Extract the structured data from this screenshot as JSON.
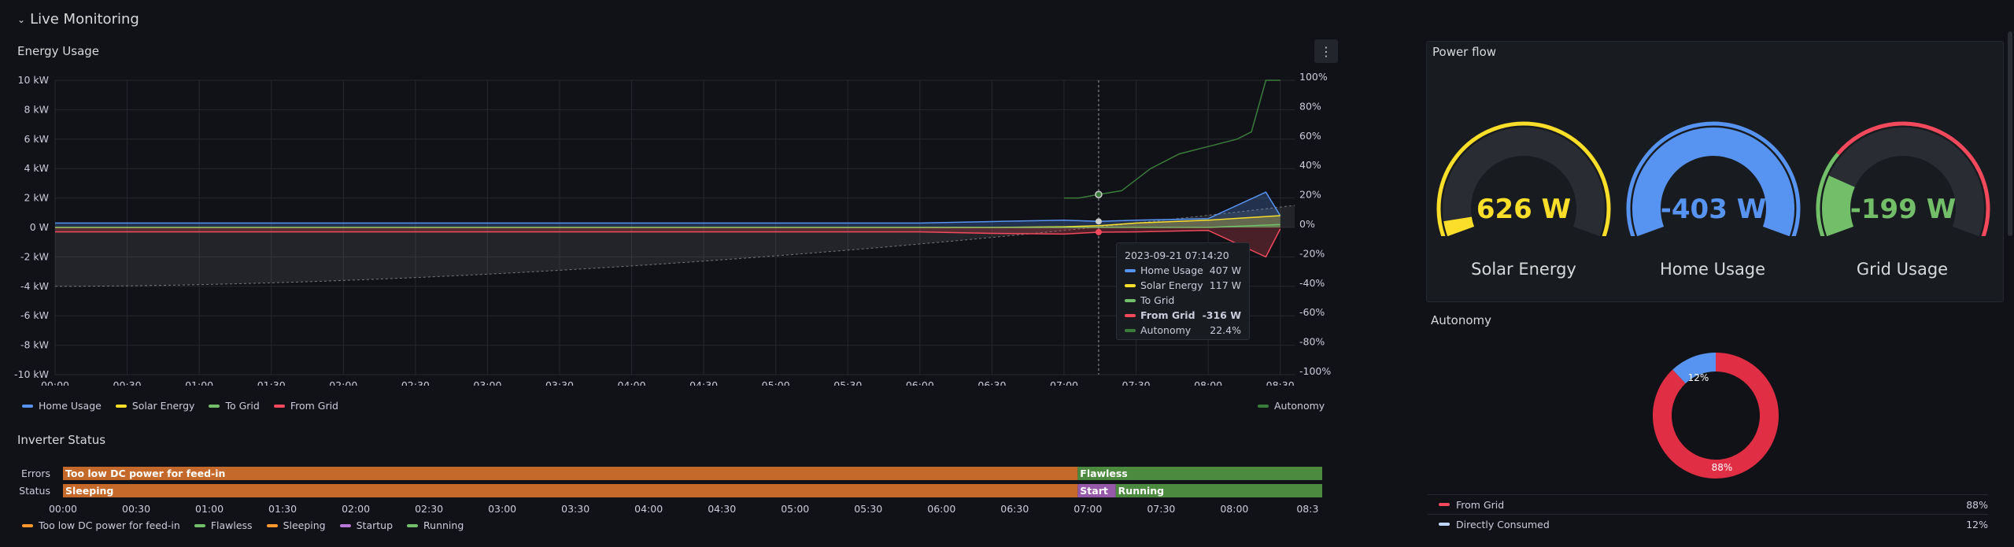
{
  "row": {
    "title": "Live Monitoring"
  },
  "energy": {
    "title": "Energy Usage",
    "menu_icon": "more-vertical-icon",
    "legend_left": [
      {
        "name": "Home Usage",
        "color": "#5794f2"
      },
      {
        "name": "Solar Energy",
        "color": "#fade2a"
      },
      {
        "name": "To Grid",
        "color": "#73bf69"
      },
      {
        "name": "From Grid",
        "color": "#f2495c"
      }
    ],
    "legend_right": {
      "name": "Autonomy",
      "color": "#3a7d3a"
    },
    "tooltip": {
      "time": "2023-09-21 07:14:20",
      "rows": [
        {
          "name": "Home Usage",
          "value": "407 W",
          "color": "#5794f2"
        },
        {
          "name": "Solar Energy",
          "value": "117 W",
          "color": "#fade2a"
        },
        {
          "name": "To Grid",
          "value": "",
          "color": "#73bf69"
        },
        {
          "name": "From Grid",
          "value": "-316 W",
          "color": "#f2495c"
        },
        {
          "name": "Autonomy",
          "value": "22.4%",
          "color": "#3a7d3a"
        }
      ]
    }
  },
  "chart_data": {
    "type": "line",
    "title": "Energy Usage",
    "x_ticks": [
      "00:00",
      "00:30",
      "01:00",
      "01:30",
      "02:00",
      "02:30",
      "03:00",
      "03:30",
      "04:00",
      "04:30",
      "05:00",
      "05:30",
      "06:00",
      "06:30",
      "07:00",
      "07:30",
      "08:00",
      "08:30"
    ],
    "y_left_ticks": [
      "10 kW",
      "8 kW",
      "6 kW",
      "4 kW",
      "2 kW",
      "0 W",
      "-2 kW",
      "-4 kW",
      "-6 kW",
      "-8 kW",
      "-10 kW"
    ],
    "y_left_range_kw": [
      -10,
      10
    ],
    "y_right_ticks": [
      "100%",
      "80%",
      "60%",
      "40%",
      "20%",
      "0%",
      "-20%",
      "-40%",
      "-60%",
      "-80%",
      "-100%"
    ],
    "y_right_range_pct": [
      -100,
      100
    ],
    "series": [
      {
        "name": "Home Usage",
        "x_hours": [
          0,
          1,
          2,
          3,
          4,
          5,
          6,
          6.5,
          7,
          7.24,
          7.5,
          8,
          8.4,
          8.5
        ],
        "values_kw": [
          0.3,
          0.3,
          0.3,
          0.3,
          0.3,
          0.3,
          0.3,
          0.4,
          0.5,
          0.41,
          0.5,
          0.6,
          2.4,
          0.8
        ]
      },
      {
        "name": "Solar Energy",
        "x_hours": [
          0,
          6,
          6.5,
          7,
          7.24,
          7.5,
          8,
          8.5
        ],
        "values_kw": [
          0,
          0,
          0,
          0.05,
          0.12,
          0.3,
          0.5,
          0.8
        ]
      },
      {
        "name": "To Grid",
        "x_hours": [
          0,
          8,
          8.5
        ],
        "values_kw": [
          0,
          0,
          0.2
        ]
      },
      {
        "name": "From Grid",
        "x_hours": [
          0,
          1,
          2,
          3,
          4,
          5,
          6,
          6.5,
          7,
          7.24,
          7.5,
          8,
          8.4,
          8.5
        ],
        "values_kw": [
          -0.3,
          -0.3,
          -0.3,
          -0.3,
          -0.3,
          -0.3,
          -0.3,
          -0.4,
          -0.45,
          -0.32,
          -0.3,
          -0.2,
          -2,
          -0.1
        ]
      },
      {
        "name": "Autonomy",
        "x_hours": [
          7.0,
          7.1,
          7.24,
          7.4,
          7.6,
          7.8,
          8.0,
          8.2,
          8.3,
          8.4,
          8.45,
          8.5
        ],
        "values_pct": [
          20,
          20,
          22.4,
          25,
          40,
          50,
          55,
          60,
          65,
          100,
          100,
          100
        ]
      }
    ]
  },
  "inverter": {
    "title": "Inverter Status",
    "rows": [
      {
        "label": "Errors",
        "segments": [
          {
            "text": "Too low DC power for feed-in",
            "start_h": 0,
            "end_h": 6.93,
            "color": "#c4692a"
          },
          {
            "text": "Flawless",
            "start_h": 6.93,
            "end_h": 8.6,
            "color": "#4b8a3f"
          }
        ]
      },
      {
        "label": "Status",
        "segments": [
          {
            "text": "Sleeping",
            "start_h": 0,
            "end_h": 6.93,
            "color": "#c4692a"
          },
          {
            "text": "Start",
            "start_h": 6.93,
            "end_h": 7.19,
            "color": "#9658a8"
          },
          {
            "text": "Running",
            "start_h": 7.19,
            "end_h": 8.6,
            "color": "#4b8a3f"
          }
        ]
      }
    ],
    "x_ticks": [
      "00:00",
      "00:30",
      "01:00",
      "01:30",
      "02:00",
      "02:30",
      "03:00",
      "03:30",
      "04:00",
      "04:30",
      "05:00",
      "05:30",
      "06:00",
      "06:30",
      "07:00",
      "07:30",
      "08:00",
      "08:3"
    ],
    "legend": [
      {
        "name": "Too low DC power for feed-in",
        "color": "#ff9830"
      },
      {
        "name": "Flawless",
        "color": "#73bf69"
      },
      {
        "name": "Sleeping",
        "color": "#ff9830"
      },
      {
        "name": "Startup",
        "color": "#b877d9"
      },
      {
        "name": "Running",
        "color": "#73bf69"
      }
    ]
  },
  "power_flow": {
    "title": "Power flow",
    "gauges": [
      {
        "label": "Solar Energy",
        "value_text": "626 W",
        "color": "#fade2a",
        "fill_fraction": 0.05
      },
      {
        "label": "Home Usage",
        "value_text": "-403 W",
        "color": "#5794f2",
        "fill_fraction": 1.0
      },
      {
        "label": "Grid Usage",
        "value_text": "-199 W",
        "color": "#73bf69",
        "fill_fraction": 0.2,
        "threshold_color": "#f2495c"
      }
    ]
  },
  "autonomy": {
    "title": "Autonomy",
    "slices": [
      {
        "name": "From Grid",
        "value": "88%",
        "pct": 88,
        "color": "#e02f44"
      },
      {
        "name": "Directly Consumed",
        "value": "12%",
        "pct": 12,
        "color": "#5794f2"
      }
    ],
    "legend": [
      {
        "name": "From Grid",
        "value": "88%",
        "color": "#f2495c"
      },
      {
        "name": "Directly Consumed",
        "value": "12%",
        "color": "#c0d8ff"
      }
    ]
  }
}
